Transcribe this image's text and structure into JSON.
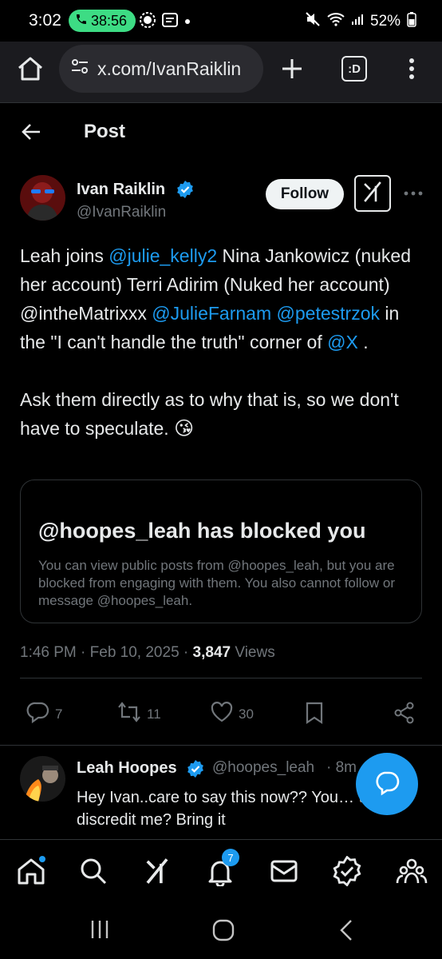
{
  "status_bar": {
    "time": "3:02",
    "call_duration": "38:56",
    "battery": "52%"
  },
  "browser": {
    "url": "x.com/IvanRaiklin",
    "tabs_label": ":D"
  },
  "header": {
    "title": "Post"
  },
  "post": {
    "author_name": "Ivan Raiklin",
    "author_handle": "@IvanRaiklin",
    "follow_label": "Follow",
    "text_parts": [
      {
        "t": "Leah joins ",
        "m": false
      },
      {
        "t": "@julie_kelly2",
        "m": true
      },
      {
        "t": " Nina Jankowicz (nuked her account) Terri Adirim (Nuked her account) @intheMatrixxx ",
        "m": false
      },
      {
        "t": "@JulieFarnam",
        "m": true
      },
      {
        "t": " ",
        "m": false
      },
      {
        "t": "@petestrzok",
        "m": true
      },
      {
        "t": " in the \"I can't handle the truth\" corner of ",
        "m": false
      },
      {
        "t": "@X",
        "m": true
      },
      {
        "t": " .",
        "m": false
      }
    ],
    "text_para2": "Ask them directly as to why that is, so we don't have to speculate.",
    "emoji": "😘",
    "blocked_card": {
      "title": "@hoopes_leah has blocked you",
      "body": "You can view public posts from @hoopes_leah, but you are blocked from engaging with them. You also cannot follow or message @hoopes_leah."
    },
    "time": "1:46 PM",
    "date": "Feb 10, 2025",
    "views_count": "3,847",
    "views_label": "Views",
    "replies": "7",
    "reposts": "11",
    "likes": "30"
  },
  "reply": {
    "author_name": "Leah Hoopes",
    "author_handle": "@hoopes_leah",
    "time_fragment": "8m",
    "text": "Hey Ivan..care to say this now?? You… to discredit me? Bring it"
  },
  "bottom_nav": {
    "notifications_badge": "7"
  },
  "colors": {
    "accent": "#1d9bf0",
    "background": "#000000",
    "secondary_text": "#71767b"
  }
}
